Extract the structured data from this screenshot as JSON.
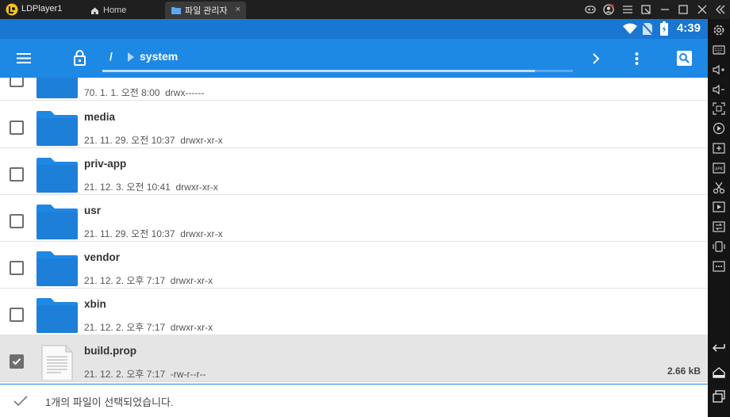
{
  "emulator": {
    "app_title": "LDPlayer1",
    "tabs": [
      {
        "label": "Home",
        "icon": "home-icon",
        "active": false
      },
      {
        "label": "파일 관리자",
        "icon": "folder-icon",
        "active": true,
        "close": "×"
      }
    ],
    "controls": [
      "gamepad-icon",
      "account-icon",
      "menu-icon",
      "popout-icon",
      "minimize-icon",
      "maximize-icon",
      "close-icon",
      "collapse-icon"
    ]
  },
  "statusbar": {
    "time": "4:39",
    "icons": [
      "wifi-icon",
      "no-sim-icon",
      "battery-icon"
    ]
  },
  "appbar": {
    "path_root": "/",
    "path_segment": "system",
    "icons": [
      "menu-icon",
      "lock-icon",
      "chevron-right-icon",
      "more-vert-icon",
      "search-icon"
    ]
  },
  "files": [
    {
      "name": "",
      "meta": "70. 1. 1. 오전 8:00  drwx------",
      "type": "folder",
      "size": "",
      "selected": false
    },
    {
      "name": "media",
      "meta": "21. 11. 29. 오전 10:37  drwxr-xr-x",
      "type": "folder",
      "size": "",
      "selected": false
    },
    {
      "name": "priv-app",
      "meta": "21. 12. 3. 오전 10:41  drwxr-xr-x",
      "type": "folder",
      "size": "",
      "selected": false
    },
    {
      "name": "usr",
      "meta": "21. 11. 29. 오전 10:37  drwxr-xr-x",
      "type": "folder",
      "size": "",
      "selected": false
    },
    {
      "name": "vendor",
      "meta": "21. 12. 2. 오후 7:17  drwxr-xr-x",
      "type": "folder",
      "size": "",
      "selected": false
    },
    {
      "name": "xbin",
      "meta": "21. 12. 2. 오후 7:17  drwxr-xr-x",
      "type": "folder",
      "size": "",
      "selected": false
    },
    {
      "name": "build.prop",
      "meta": "21. 12. 2. 오후 7:17  -rw-r--r--",
      "type": "file",
      "size": "2.66 kB",
      "selected": true
    }
  ],
  "bottombar": {
    "message": "1개의 파일이 선택되었습니다."
  },
  "colors": {
    "statusbar": "#1976d2",
    "appbar": "#1e88e5",
    "folder": "#1e88e5",
    "selected_row": "#e5e5e5"
  },
  "side_toolbar": [
    "settings-icon",
    "keyboard-icon",
    "volume-up-icon",
    "volume-down-icon",
    "screenshot-icon",
    "record-icon",
    "add-app-icon",
    "apk-icon",
    "scissors-icon",
    "video-icon",
    "sync-icon",
    "shake-icon",
    "more-icon",
    "back-icon",
    "home-icon",
    "recents-icon"
  ]
}
